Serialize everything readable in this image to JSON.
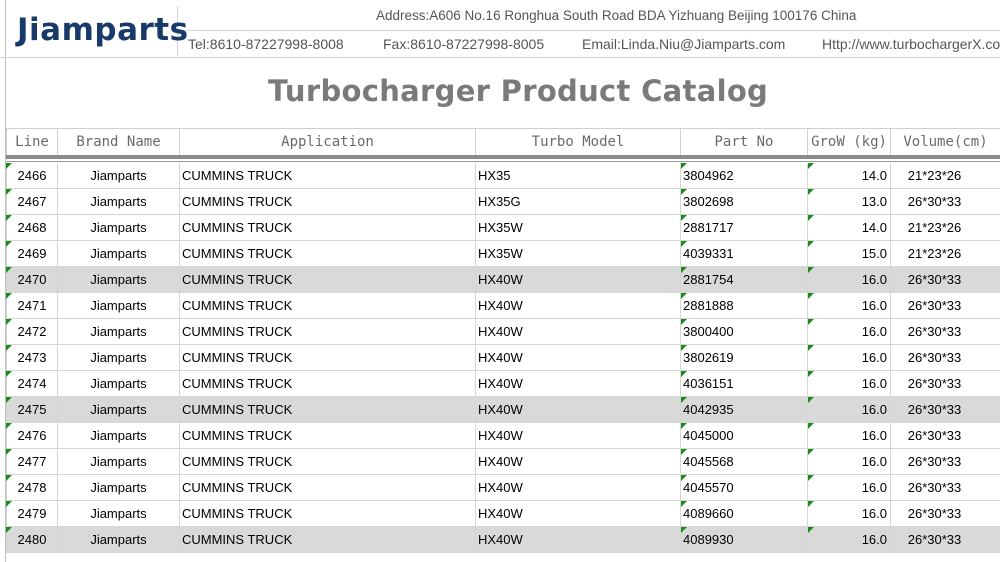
{
  "header": {
    "logo": "Jiamparts",
    "address": "Address:A606 No.16 Ronghua South Road BDA Yizhuang Beijing 100176 China",
    "tel": "Tel:8610-87227998-8008",
    "fax": "Fax:8610-87227998-8005",
    "email": "Email:Linda.Niu@Jiamparts.com",
    "website": "Http://www.turbochargerX.com",
    "title": "Turbocharger Product Catalog"
  },
  "columns": {
    "line": "Line",
    "brand": "Brand Name",
    "application": "Application",
    "turbo_model": "Turbo Model",
    "part_no": "Part No",
    "grow": "GroW (kg)",
    "volume": "Volume(cm)"
  },
  "rows": [
    {
      "line": "2466",
      "brand": "Jiamparts",
      "application": "CUMMINS TRUCK",
      "turbo": "HX35",
      "part": "3804962",
      "grow": "14.0",
      "volume": "21*23*26",
      "shaded": false
    },
    {
      "line": "2467",
      "brand": "Jiamparts",
      "application": "CUMMINS TRUCK",
      "turbo": "HX35G",
      "part": "3802698",
      "grow": "13.0",
      "volume": "26*30*33",
      "shaded": false
    },
    {
      "line": "2468",
      "brand": "Jiamparts",
      "application": "CUMMINS TRUCK",
      "turbo": "HX35W",
      "part": "2881717",
      "grow": "14.0",
      "volume": "21*23*26",
      "shaded": false
    },
    {
      "line": "2469",
      "brand": "Jiamparts",
      "application": "CUMMINS TRUCK",
      "turbo": "HX35W",
      "part": "4039331",
      "grow": "15.0",
      "volume": "21*23*26",
      "shaded": false
    },
    {
      "line": "2470",
      "brand": "Jiamparts",
      "application": "CUMMINS TRUCK",
      "turbo": "HX40W",
      "part": "2881754",
      "grow": "16.0",
      "volume": "26*30*33",
      "shaded": true
    },
    {
      "line": "2471",
      "brand": "Jiamparts",
      "application": "CUMMINS TRUCK",
      "turbo": "HX40W",
      "part": "2881888",
      "grow": "16.0",
      "volume": "26*30*33",
      "shaded": false
    },
    {
      "line": "2472",
      "brand": "Jiamparts",
      "application": "CUMMINS TRUCK",
      "turbo": "HX40W",
      "part": "3800400",
      "grow": "16.0",
      "volume": "26*30*33",
      "shaded": false
    },
    {
      "line": "2473",
      "brand": "Jiamparts",
      "application": "CUMMINS TRUCK",
      "turbo": "HX40W",
      "part": "3802619",
      "grow": "16.0",
      "volume": "26*30*33",
      "shaded": false
    },
    {
      "line": "2474",
      "brand": "Jiamparts",
      "application": "CUMMINS TRUCK",
      "turbo": "HX40W",
      "part": "4036151",
      "grow": "16.0",
      "volume": "26*30*33",
      "shaded": false
    },
    {
      "line": "2475",
      "brand": "Jiamparts",
      "application": "CUMMINS TRUCK",
      "turbo": "HX40W",
      "part": "4042935",
      "grow": "16.0",
      "volume": "26*30*33",
      "shaded": true
    },
    {
      "line": "2476",
      "brand": "Jiamparts",
      "application": "CUMMINS TRUCK",
      "turbo": "HX40W",
      "part": "4045000",
      "grow": "16.0",
      "volume": "26*30*33",
      "shaded": false
    },
    {
      "line": "2477",
      "brand": "Jiamparts",
      "application": "CUMMINS TRUCK",
      "turbo": "HX40W",
      "part": "4045568",
      "grow": "16.0",
      "volume": "26*30*33",
      "shaded": false
    },
    {
      "line": "2478",
      "brand": "Jiamparts",
      "application": "CUMMINS TRUCK",
      "turbo": "HX40W",
      "part": "4045570",
      "grow": "16.0",
      "volume": "26*30*33",
      "shaded": false
    },
    {
      "line": "2479",
      "brand": "Jiamparts",
      "application": "CUMMINS TRUCK",
      "turbo": "HX40W",
      "part": "4089660",
      "grow": "16.0",
      "volume": "26*30*33",
      "shaded": false
    },
    {
      "line": "2480",
      "brand": "Jiamparts",
      "application": "CUMMINS TRUCK",
      "turbo": "HX40W",
      "part": "4089930",
      "grow": "16.0",
      "volume": "26*30*33",
      "shaded": true
    }
  ],
  "colors": {
    "logo": "#173a6a",
    "title": "#7a7a7a",
    "comment_marker": "#1a8a1a",
    "row_shade": "#d9d9d9"
  }
}
